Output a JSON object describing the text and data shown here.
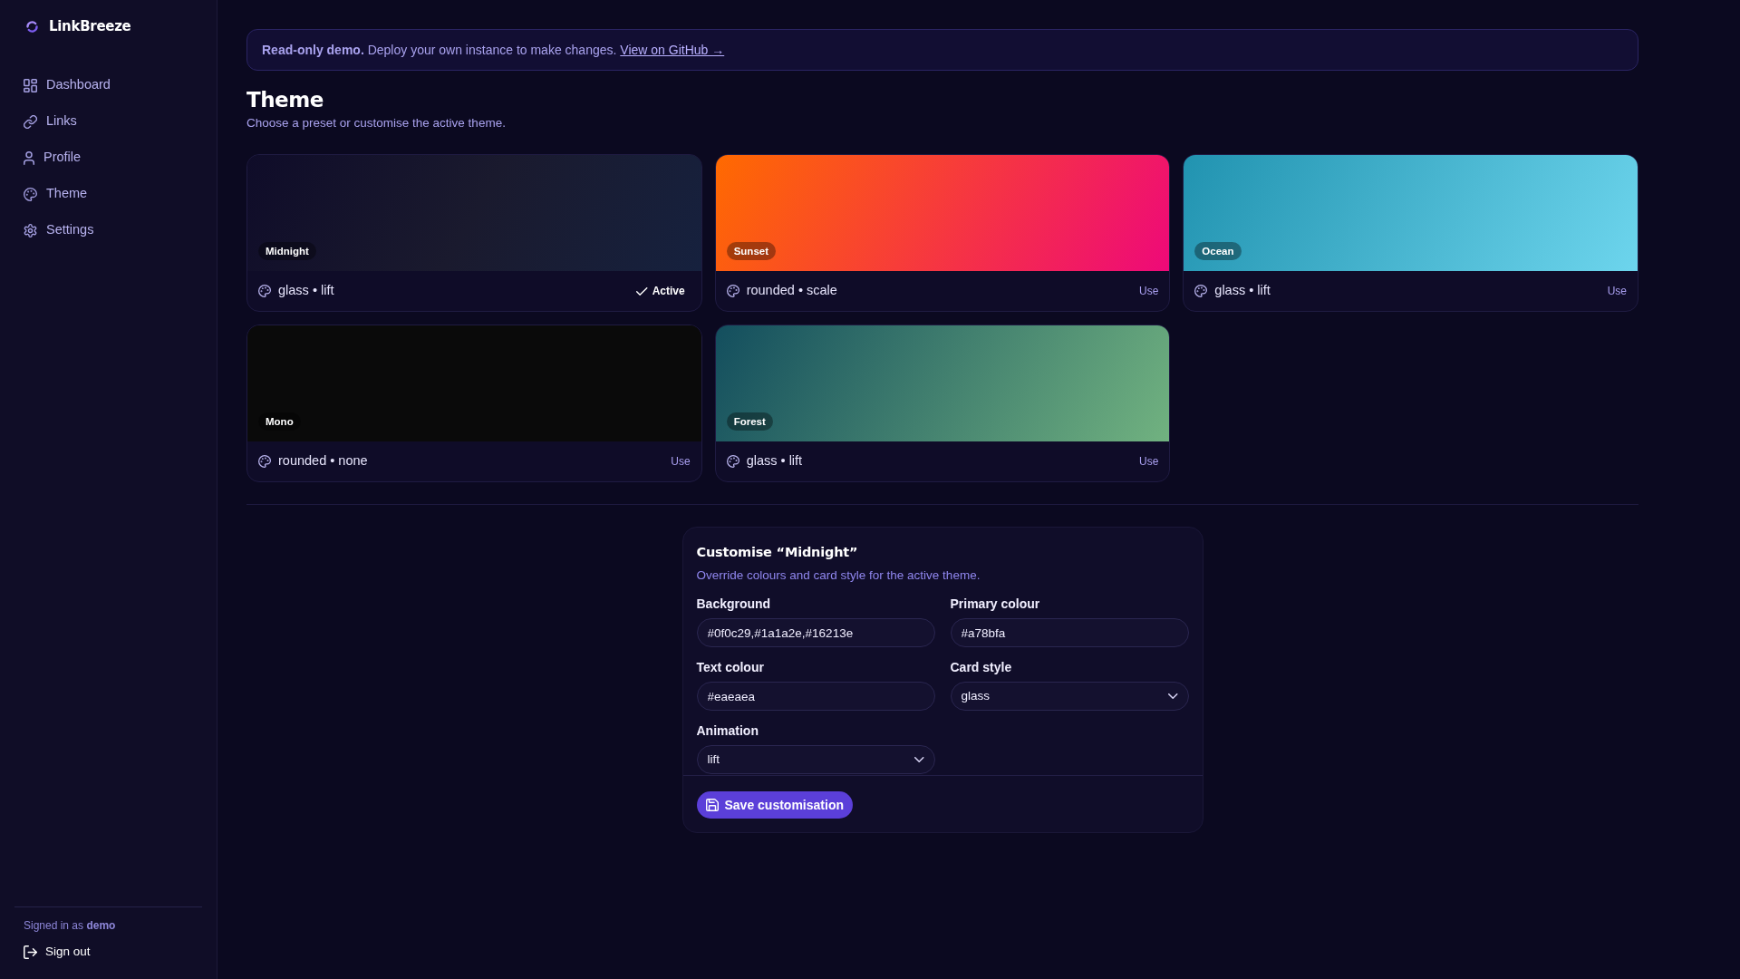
{
  "sidebar": {
    "brand": "LinkBreeze",
    "items": [
      {
        "label": "Dashboard"
      },
      {
        "label": "Links"
      },
      {
        "label": "Profile"
      },
      {
        "label": "Theme"
      },
      {
        "label": "Settings"
      }
    ],
    "signed_in": "Signed in as **demo**",
    "sign_out": "Sign out"
  },
  "notice": {
    "text": "**Read-only demo.** Deploy your own instance to make changes.",
    "link": "View on GitHub →"
  },
  "page": {
    "title": "Theme",
    "subtitle": "Choose a preset or customise the active theme."
  },
  "presets": [
    {
      "name": "Midnight",
      "stops": [
        {
          "color": "#0f0c29"
        },
        {
          "color": "#1a1a2e"
        },
        {
          "color": "#16213e"
        }
      ],
      "style": "glass • lift",
      "action": "Active",
      "selected": true
    },
    {
      "name": "Sunset",
      "stops": [
        {
          "color": "#ff6a00"
        },
        {
          "color": "#ee0979"
        }
      ],
      "style": "rounded • scale",
      "action": "Use",
      "selected": false
    },
    {
      "name": "Ocean",
      "stops": [
        {
          "color": "#2193b0"
        },
        {
          "color": "#6dd5ed"
        }
      ],
      "style": "glass • lift",
      "action": "Use",
      "selected": false
    },
    {
      "name": "Mono",
      "stops": [
        {
          "color": "#0a0a0a"
        }
      ],
      "style": "rounded • none",
      "action": "Use",
      "selected": false
    },
    {
      "name": "Forest",
      "stops": [
        {
          "color": "#134e5e"
        },
        {
          "color": "#71b280"
        }
      ],
      "style": "glass • lift",
      "action": "Use",
      "selected": false
    }
  ],
  "customise": {
    "title": "Customise “Midnight”",
    "subtitle": "Override colours and card style for the active theme.",
    "fields": [
      {
        "kind": "text",
        "label": "Background",
        "value": "#0f0c29,#1a1a2e,#16213e"
      },
      {
        "kind": "text",
        "label": "Primary colour",
        "value": "#a78bfa"
      },
      {
        "kind": "text",
        "label": "Text colour",
        "value": "#eaeaea"
      },
      {
        "kind": "select",
        "label": "Card style",
        "value": "glass"
      },
      {
        "kind": "select",
        "label": "Animation",
        "value": "lift"
      }
    ],
    "save_button": "Save customisation"
  }
}
